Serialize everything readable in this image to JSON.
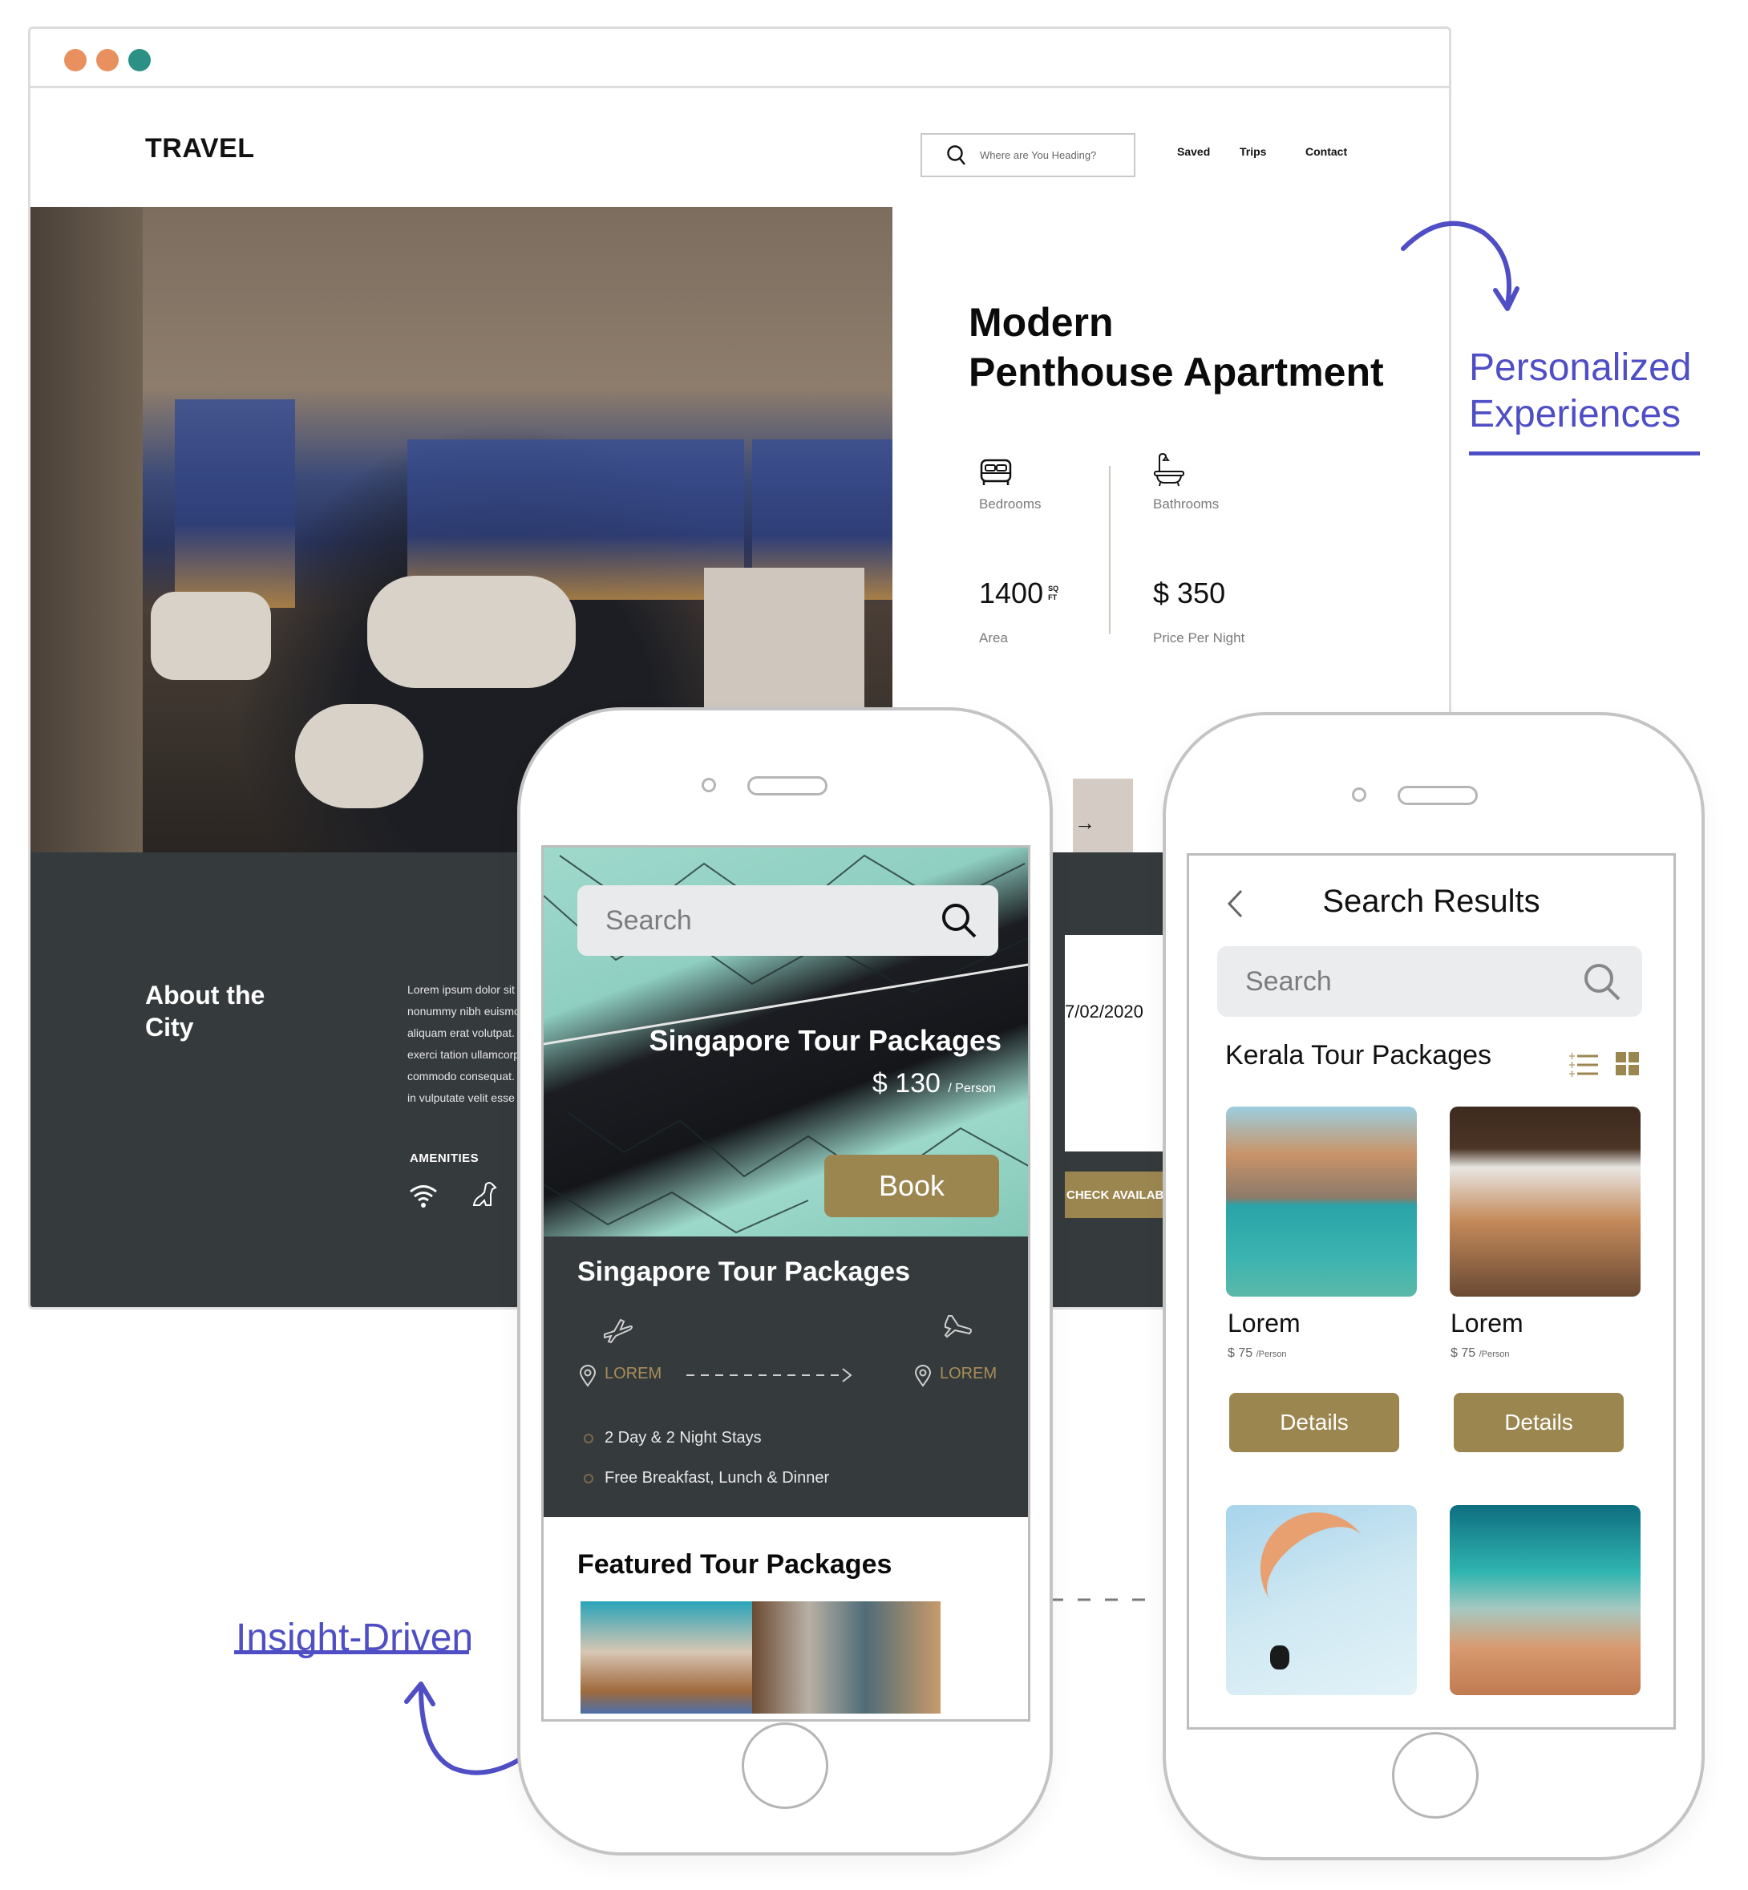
{
  "browser": {
    "window_dots": [
      {
        "name": "close",
        "color": "#e8915f"
      },
      {
        "name": "minimize",
        "color": "#e8915f"
      },
      {
        "name": "maximize",
        "color": "#2b9185"
      }
    ],
    "logo": "TRAVEL",
    "search": {
      "placeholder": "Where are You Heading?",
      "icon": "search-icon"
    },
    "nav": [
      "Saved",
      "Trips",
      "Contact"
    ],
    "property": {
      "title_line1": "Modern",
      "title_line2": "Penthouse Apartment",
      "stats": [
        {
          "icon": "bed-icon",
          "label": "Bedrooms"
        },
        {
          "icon": "bathtub-icon",
          "label": "Bathrooms"
        },
        {
          "value": "1400",
          "unit_top": "SQ",
          "unit_bottom": "FT",
          "label": "Area"
        },
        {
          "value": "$ 350",
          "label": "Price Per Night"
        }
      ]
    },
    "next_arrow": "→",
    "about": {
      "title_line1": "About the",
      "title_line2": "City",
      "body_lines": [
        "Lorem ipsum dolor sit",
        "nonummy nibh euismo",
        "aliquam erat volutpat.",
        "exerci tation ullamcorp",
        "commodo consequat.",
        "in vulputate velit esse"
      ],
      "amenities_label": "AMENITIES",
      "amenities_icons": [
        "wifi-icon",
        "pet-dog-icon"
      ]
    },
    "booking": {
      "date": "7/02/2020",
      "check_button": "CHECK AVAILAB"
    }
  },
  "phone1": {
    "search_placeholder": "Search",
    "hero": {
      "title": "Singapore Tour Packages",
      "price": "$ 130",
      "price_unit": "/ Person",
      "book_button": "Book"
    },
    "details": {
      "title": "Singapore Tour Packages",
      "from_label": "LOREM",
      "to_label": "LOREM",
      "features": [
        "2 Day & 2 Night Stays",
        "Free Breakfast, Lunch & Dinner"
      ]
    },
    "featured_title": "Featured Tour Packages"
  },
  "phone2": {
    "title": "Search Results",
    "search_placeholder": "Search",
    "section_title": "Kerala Tour Packages",
    "view_icons": [
      "list-view-icon",
      "grid-view-icon"
    ],
    "results": [
      {
        "name": "Lorem",
        "price": "$ 75",
        "unit": "/Person",
        "button": "Details",
        "image": "lake-boat"
      },
      {
        "name": "Lorem",
        "price": "$ 75",
        "unit": "/Person",
        "button": "Details",
        "image": "safari-elephant"
      }
    ],
    "more_images": [
      "paragliding",
      "snorkeling"
    ]
  },
  "annotations": {
    "top_right": [
      "Personalized",
      "Experiences"
    ],
    "bottom_left": "Insight-Driven"
  },
  "colors": {
    "accent_gold": "#9c8650",
    "annotation_purple": "#4f4ec4",
    "dark_band": "#353a3d"
  }
}
